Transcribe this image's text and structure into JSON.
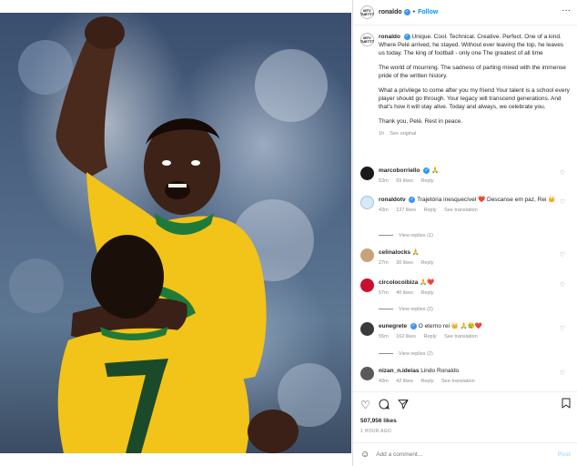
{
  "header": {
    "avatar_text": "MTV TUETTT",
    "username": "ronaldo",
    "dot": "•",
    "follow_label": "Follow",
    "more_label": "···"
  },
  "caption": {
    "username": "ronaldo",
    "paragraphs": [
      "Unique. Cool. Technical. Creative. Perfect. One of a kind. Where Pelé arrived, he stayed. Without ever leaving the top, he leaves us today. The king of football - only one The greatest of all time",
      "The world of mourning. The sadness of parting mixed with the immense pride of the written history.",
      "What a privilege to come after you my friend Your talent is a school every player should go through. Your legacy will transcend generations. And that's how it will stay alive. Today and always, we celebrate you.",
      "Thank you, Pelé. Rest in peace."
    ],
    "time": "1h",
    "see_original": "See original"
  },
  "comments": [
    {
      "username": "marcoborriello",
      "text": "🙏",
      "time": "53m",
      "likes": "69 likes",
      "reply": "Reply",
      "see_translation": "",
      "avatar_color": "#1a1a1a"
    },
    {
      "username": "ronaldotv",
      "text": "Trajetória inesquecível ❤️ Descanse em paz, Rei 👑",
      "time": "43m",
      "likes": "137 likes",
      "reply": "Reply",
      "see_translation": "See translation",
      "avatar_color": "#d7e9f7"
    },
    {
      "username": "celinalocks",
      "text": "🙏",
      "time": "27m",
      "likes": "30 likes",
      "reply": "Reply",
      "see_translation": "",
      "avatar_color": "#c9a27a"
    },
    {
      "username": "circolocoibiza",
      "text": "🙏❤️",
      "time": "57m",
      "likes": "40 likes",
      "reply": "Reply",
      "see_translation": "",
      "avatar_color": "#c8102e"
    },
    {
      "username": "eunegrete",
      "text": "O eterno rei 👑 🙏😢❤️",
      "time": "55m",
      "likes": "162 likes",
      "reply": "Reply",
      "see_translation": "See translation",
      "avatar_color": "#3a3a3a"
    },
    {
      "username": "nizan_n.ideias",
      "text": "Lindo Ronaldo",
      "time": "43m",
      "likes": "42 likes",
      "reply": "Reply",
      "see_translation": "See translation",
      "avatar_color": "#5a5a5a"
    }
  ],
  "view_replies": [
    "View replies (1)",
    "View replies (2)",
    "View replies (2)"
  ],
  "actions": {
    "likes": "507,956 likes",
    "time_ago": "1 HOUR AGO"
  },
  "add_comment": {
    "placeholder": "Add a comment...",
    "post_label": "Post"
  },
  "icons": {
    "like": "heart-icon",
    "comment": "comment-icon",
    "share": "share-icon",
    "save": "bookmark-icon",
    "emoji": "smiley-icon",
    "more": "more-icon"
  },
  "colors": {
    "accent": "#0095f6",
    "verified": "#3897f0",
    "post_disabled": "#b3dbff"
  }
}
